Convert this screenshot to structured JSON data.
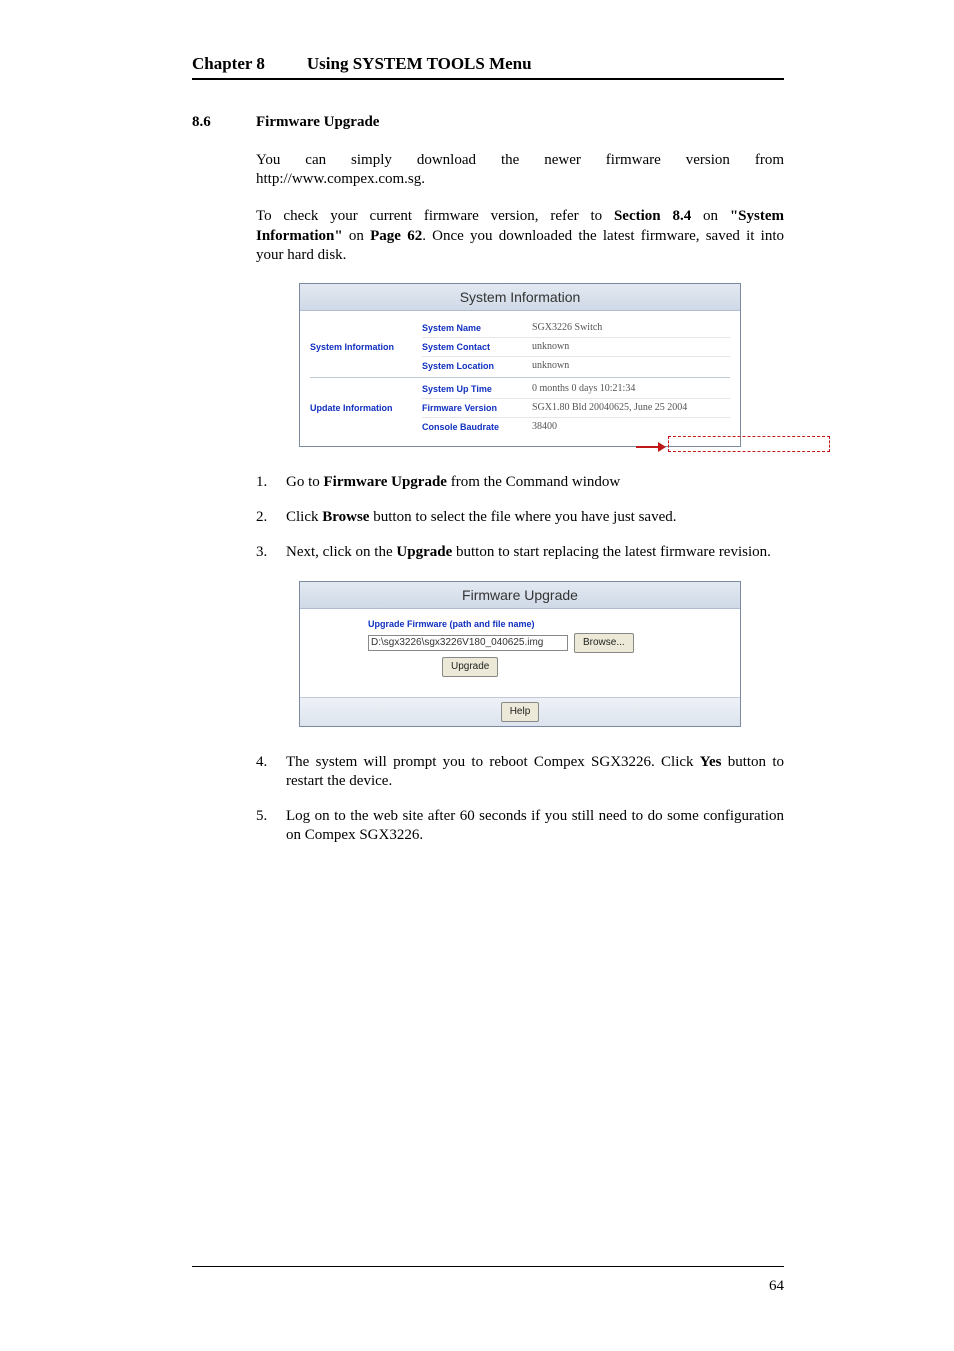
{
  "chapter": {
    "label": "Chapter 8",
    "title": "Using SYSTEM TOOLS Menu"
  },
  "section": {
    "num": "8.6",
    "title": "Firmware Upgrade"
  },
  "para1": "You can simply download the newer firmware version from http://www.compex.com.sg.",
  "para2_a": "To check your current firmware version, refer to ",
  "para2_b": "Section 8.4",
  "para2_c": " on ",
  "para2_d": "\"System Information\"",
  "para2_e": " on ",
  "para2_f": "Page 62",
  "para2_g": ". Once you downloaded the latest firmware, saved it into your hard disk.",
  "sysinfo": {
    "title": "System Information",
    "sec1": {
      "label": "System Information",
      "rows": [
        {
          "k": "System Name",
          "v": "SGX3226 Switch"
        },
        {
          "k": "System Contact",
          "v": "unknown"
        },
        {
          "k": "System Location",
          "v": "unknown"
        }
      ]
    },
    "sec2": {
      "label": "Update Information",
      "rows": [
        {
          "k": "System Up Time",
          "v": "0 months 0 days 10:21:34"
        },
        {
          "k": "Firmware Version",
          "v": "SGX1.80 Bld 20040625, June 25 2004"
        },
        {
          "k": "Console Baudrate",
          "v": "38400"
        }
      ]
    }
  },
  "list1": {
    "i1_a": "Go to ",
    "i1_b": "Firmware Upgrade",
    "i1_c": " from the Command window",
    "i2_a": "Click ",
    "i2_b": "Browse",
    "i2_c": " button to select the file where you have just saved.",
    "i3_a": "Next, click on the ",
    "i3_b": "Upgrade",
    "i3_c": " button to start replacing the latest firmware revision."
  },
  "fw": {
    "title": "Firmware Upgrade",
    "label": "Upgrade Firmware (path and file name)",
    "path": "D:\\sgx3226\\sgx3226V180_040625.img",
    "browse": "Browse...",
    "upgrade": "Upgrade",
    "help": "Help"
  },
  "list2": {
    "i4_a": "The system will prompt you to reboot Compex SGX3226. Click ",
    "i4_b": "Yes",
    "i4_c": " button to restart the device.",
    "i5": "Log on to the web site after 60 seconds if you still need to do some configuration on Compex SGX3226."
  },
  "page_number": "64",
  "nums": {
    "n1": "1.",
    "n2": "2.",
    "n3": "3.",
    "n4": "4.",
    "n5": "5."
  }
}
